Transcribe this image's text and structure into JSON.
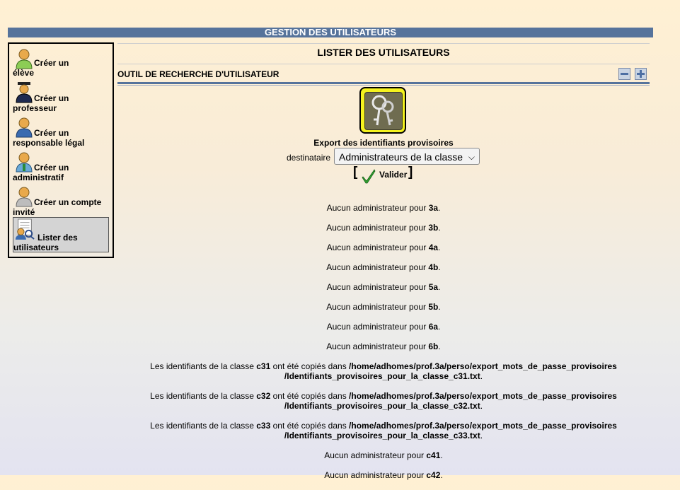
{
  "header": {
    "title": "GESTION DES UTILISATEURS"
  },
  "sidebar": {
    "items": [
      {
        "label_line1": "Créer un",
        "label_line2": "élève",
        "icon": "student-icon"
      },
      {
        "label_line1": "Créer un",
        "label_line2": "professeur",
        "icon": "teacher-icon"
      },
      {
        "label_line1": "Créer un",
        "label_line2": "responsable légal",
        "icon": "parent-icon"
      },
      {
        "label_line1": "Créer un",
        "label_line2": "administratif",
        "icon": "admin-icon"
      },
      {
        "label_line1": "Créer un compte",
        "label_line2": "invité",
        "icon": "guest-icon"
      },
      {
        "label_line1": "Lister des",
        "label_line2": "utilisateurs",
        "icon": "list-users-icon",
        "selected": true
      }
    ]
  },
  "main": {
    "title": "LISTER DES UTILISATEURS",
    "tool_title": "OUTIL DE RECHERCHE D'UTILISATEUR",
    "export_title": "Export des identifiants provisoires",
    "dest_label": "destinataire",
    "dest_value": "Administrateurs de la classe",
    "valider_label": "Valider",
    "messages": [
      {
        "pre": "Aucun administrateur pour ",
        "cls": "3a",
        "post": "."
      },
      {
        "pre": "Aucun administrateur pour ",
        "cls": "3b",
        "post": "."
      },
      {
        "pre": "Aucun administrateur pour ",
        "cls": "4a",
        "post": "."
      },
      {
        "pre": "Aucun administrateur pour ",
        "cls": "4b",
        "post": "."
      },
      {
        "pre": "Aucun administrateur pour ",
        "cls": "5a",
        "post": "."
      },
      {
        "pre": "Aucun administrateur pour ",
        "cls": "5b",
        "post": "."
      },
      {
        "pre": "Aucun administrateur pour ",
        "cls": "6a",
        "post": "."
      },
      {
        "pre": "Aucun administrateur pour ",
        "cls": "6b",
        "post": "."
      },
      {
        "pre": "Les identifiants de la classe ",
        "cls": "c31",
        "mid": " ont été copiés dans ",
        "path1": "/home/adhomes/prof.3a/perso/export_mots_de_passe_provisoires",
        "path2": "/Identifiants_provisoires_pour_la_classe_c31.txt",
        "post": "."
      },
      {
        "pre": "Les identifiants de la classe ",
        "cls": "c32",
        "mid": " ont été copiés dans ",
        "path1": "/home/adhomes/prof.3a/perso/export_mots_de_passe_provisoires",
        "path2": "/Identifiants_provisoires_pour_la_classe_c32.txt",
        "post": "."
      },
      {
        "pre": "Les identifiants de la classe ",
        "cls": "c33",
        "mid": " ont été copiés dans ",
        "path1": "/home/adhomes/prof.3a/perso/export_mots_de_passe_provisoires",
        "path2": "/Identifiants_provisoires_pour_la_classe_c33.txt",
        "post": "."
      },
      {
        "pre": "Aucun administrateur pour ",
        "cls": "c41",
        "post": "."
      },
      {
        "pre": "Aucun administrateur pour ",
        "cls": "c42",
        "post": "."
      }
    ]
  }
}
